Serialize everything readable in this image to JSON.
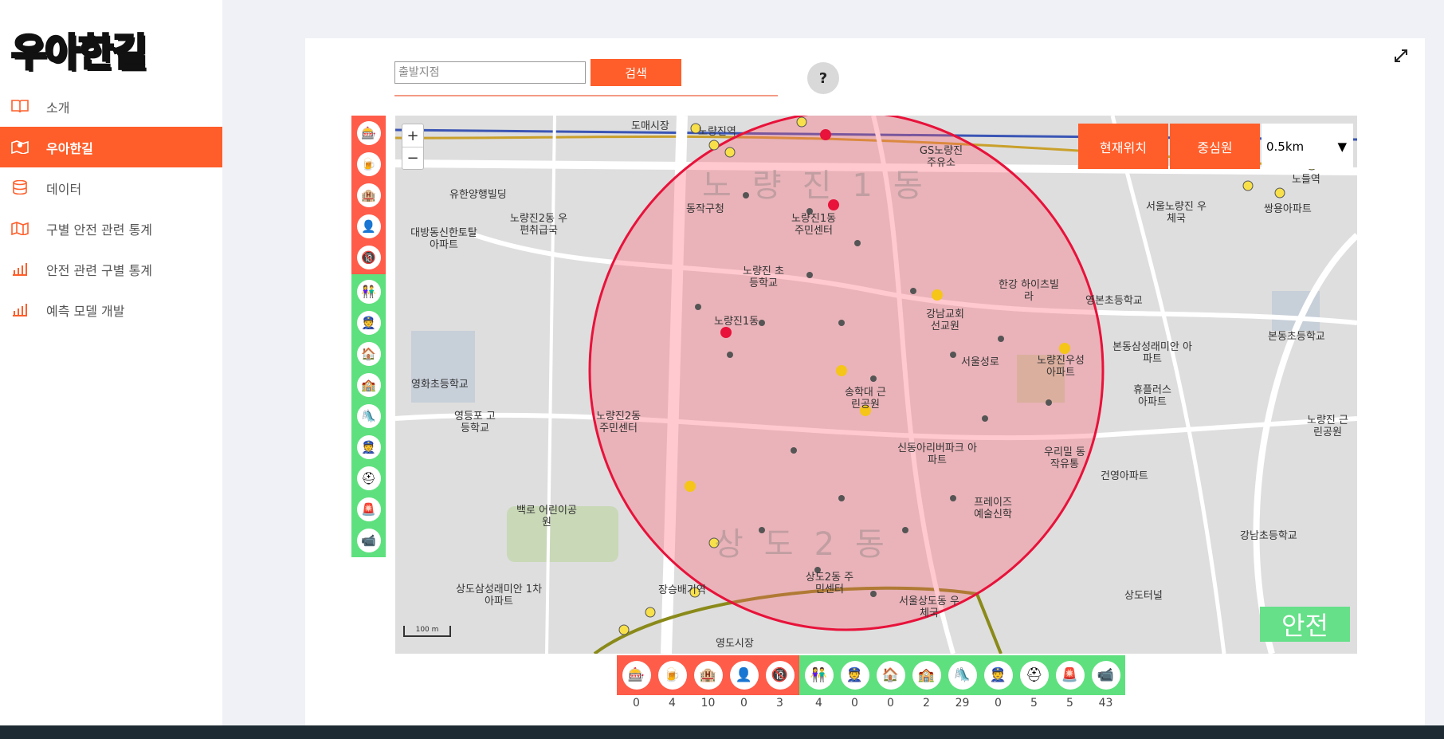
{
  "logo": "우아한길",
  "nav": {
    "items": [
      {
        "label": "소개",
        "icon": "book-icon"
      },
      {
        "label": "우아한길",
        "icon": "map-pin-icon",
        "active": true
      },
      {
        "label": "데이터",
        "icon": "database-icon"
      },
      {
        "label": "구별 안전 관련 통계",
        "icon": "map-icon"
      },
      {
        "label": "안전 관련 구별 통계",
        "icon": "bar-chart-icon"
      },
      {
        "label": "예측 모델 개발",
        "icon": "bar-chart-icon"
      }
    ]
  },
  "search": {
    "placeholder": "출발지점",
    "value": "",
    "button": "검색"
  },
  "help": "?",
  "map": {
    "controls": {
      "current_location": "현재위치",
      "center_circle": "중심원",
      "radius": "0.5km"
    },
    "zoom_in": "+",
    "zoom_out": "−",
    "scale": "100 m",
    "safety_status": "안전",
    "districts": [
      "노량진1동",
      "상도2동"
    ],
    "labels": [
      "도매시장",
      "노량진역",
      "GS노량진 주유소",
      "동작구청",
      "유한양행빌딩",
      "노량진2동 우편취급국",
      "대방동신한토탈 아파트",
      "노량진1동 주민센터",
      "노량진 초등학교",
      "노량진1동",
      "한강 하이츠빌라",
      "영본초등학교",
      "강남교회 선교원",
      "서울성로",
      "노량진우성 아파트",
      "본동삼성래미안 아파트",
      "송학대 근린공원",
      "휴플러스 아파트",
      "영화초등학교",
      "영등포 고등학교",
      "노량진2동 주민센터",
      "신동아리버파크 아파트",
      "우리밀 동작유통",
      "건영아파트",
      "프레이즈 예술신학",
      "백로 어린이공원",
      "상도2동 주민센터",
      "서울상도동 우체국",
      "상도삼성래미안 1차아파트",
      "영도시장",
      "서울노량진 우체국",
      "쌍용아파트",
      "본동초등학교",
      "노량진 근린공원",
      "강남초등학교",
      "상도터널",
      "노들역",
      "장승배기역"
    ]
  },
  "categories": {
    "danger": [
      {
        "icon": "adult-entertainment-icon",
        "count": "0"
      },
      {
        "icon": "bar-pub-icon",
        "count": "4"
      },
      {
        "icon": "hotel-icon",
        "count": "10"
      },
      {
        "icon": "sex-offender-icon",
        "count": "0"
      },
      {
        "icon": "no-minors-icon",
        "count": "3"
      }
    ],
    "safe": [
      {
        "icon": "children-icon",
        "count": "4"
      },
      {
        "icon": "guard-icon",
        "count": "0"
      },
      {
        "icon": "police-station-icon",
        "count": "0"
      },
      {
        "icon": "school-icon",
        "count": "2"
      },
      {
        "icon": "playground-icon",
        "count": "29"
      },
      {
        "icon": "police-officer-icon",
        "count": "0"
      },
      {
        "icon": "safety-helmet-icon",
        "count": "5"
      },
      {
        "icon": "emergency-bell-icon",
        "count": "5"
      },
      {
        "icon": "cctv-icon",
        "count": "43"
      }
    ]
  }
}
